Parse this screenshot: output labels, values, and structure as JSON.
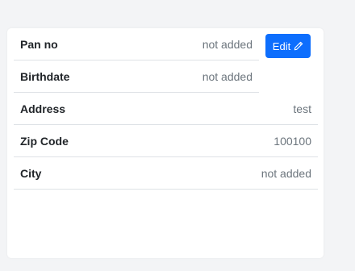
{
  "profile": {
    "fields": [
      {
        "label": "Pan no",
        "value": "not added"
      },
      {
        "label": "Birthdate",
        "value": "not added"
      },
      {
        "label": "Address",
        "value": "test"
      },
      {
        "label": "Zip Code",
        "value": "100100"
      },
      {
        "label": "City",
        "value": "not added"
      }
    ],
    "edit_label": "Edit",
    "edit_icon": "pencil-icon"
  },
  "colors": {
    "accent": "#0d6efd",
    "background": "#f3f4f6",
    "card": "#ffffff",
    "divider": "#dee2e6",
    "muted_text": "#6c757d"
  }
}
